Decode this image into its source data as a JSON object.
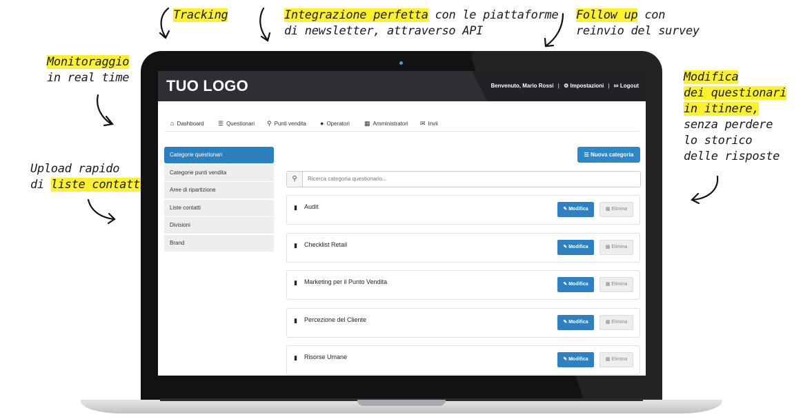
{
  "annotations": {
    "tracking": "Tracking",
    "integration_hl": "Integrazione perfetta",
    "integration_rest1": " con le piattaforme",
    "integration_line2": "di newsletter, attraverso API",
    "followup_hl": "Follow up",
    "followup_rest1": " con",
    "followup_line2": "reinvio del survey",
    "monitoring_hl": "Monitoraggio",
    "monitoring_line2": "in real time",
    "upload_line1": "Upload rapido",
    "upload_prefix": "di ",
    "upload_hl": "liste contatti",
    "edit_hl1": "Modifica",
    "edit_hl2": "dei questionari",
    "edit_hl3": "in itinere,",
    "edit_line4": "senza perdere",
    "edit_line5": "lo storico",
    "edit_line6": "delle risposte"
  },
  "app": {
    "logo": "TUO LOGO",
    "welcome": "Benvenuto, Mario Rossi",
    "separator": "|",
    "settings_label": "Impostazioni",
    "logout_label": "Logout"
  },
  "nav": {
    "dashboard": "Dashboard",
    "questionari": "Questionari",
    "punti_vendita": "Punti vendita",
    "operatori": "Operatori",
    "amministratori": "Amministratori",
    "invii": "Invii"
  },
  "sidebar": {
    "items": [
      "Categorie questionari",
      "Categorie punti vendita",
      "Aree di ripartizione",
      "Liste contatti",
      "Divisioni",
      "Brand"
    ]
  },
  "main": {
    "new_category_label": "Nuova categoria",
    "search_placeholder": "Ricerca categoria questionario...",
    "edit_label": "Modifica",
    "delete_label": "Elimina",
    "rows": [
      "Audit",
      "Checklist Retail",
      "Marketing per il Punto Vendita",
      "Percezione del Cliente",
      "Risorse Umane"
    ]
  },
  "colors": {
    "highlight": "#fbf22b",
    "primary": "#2e80c3",
    "topbar": "#2e3036"
  }
}
